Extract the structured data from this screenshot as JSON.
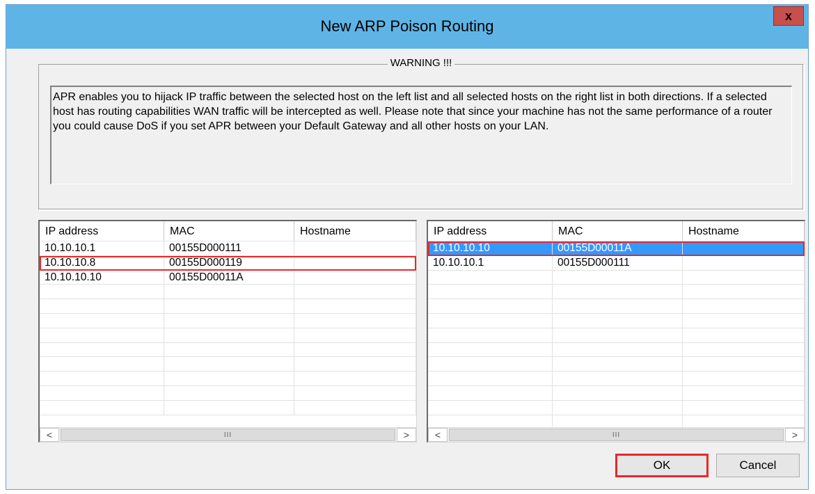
{
  "window": {
    "title": "New ARP Poison Routing",
    "close_label": "x"
  },
  "warning": {
    "legend": "WARNING !!!",
    "text": "APR enables you to hijack IP traffic between the selected host on the left list and all selected hosts on the right list in both directions. If a selected host has routing capabilities WAN traffic will be intercepted as well. Please note that since your machine has not the same performance of a router you could cause DoS if you set APR between your Default Gateway and all other hosts on your LAN."
  },
  "left_list": {
    "columns": [
      "IP address",
      "MAC",
      "Hostname"
    ],
    "rows": [
      {
        "ip": "10.10.10.1",
        "mac": "00155D000111",
        "hostname": ""
      },
      {
        "ip": "10.10.10.8",
        "mac": "00155D000119",
        "hostname": ""
      },
      {
        "ip": "10.10.10.10",
        "mac": "00155D00011A",
        "hostname": ""
      }
    ]
  },
  "right_list": {
    "columns": [
      "IP address",
      "MAC",
      "Hostname"
    ],
    "rows": [
      {
        "ip": "10.10.10.10",
        "mac": "00155D00011A",
        "hostname": ""
      },
      {
        "ip": "10.10.10.1",
        "mac": "00155D000111",
        "hostname": ""
      }
    ]
  },
  "scrollbar": {
    "left_arrow": "<",
    "right_arrow": ">",
    "grip": "III"
  },
  "buttons": {
    "ok": "OK",
    "cancel": "Cancel"
  },
  "colors": {
    "titlebar": "#5fb4e6",
    "selection": "#3399ff",
    "highlight_box": "#e8282a"
  }
}
